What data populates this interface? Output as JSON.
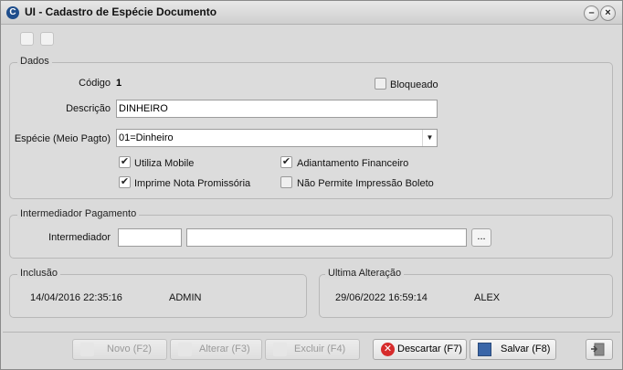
{
  "window": {
    "title": "UI - Cadastro de Espécie Documento",
    "min_symbol": "–",
    "close_symbol": "×",
    "app_icon_letter": "C"
  },
  "dados": {
    "group_label": "Dados",
    "codigo_label": "Código",
    "codigo_value": "1",
    "bloqueado_label": "Bloqueado",
    "bloqueado_checked": false,
    "descricao_label": "Descrição",
    "descricao_value": "DINHEIRO",
    "especie_label": "Espécie (Meio Pagto)",
    "especie_value": "01=Dinheiro",
    "checkboxes": [
      {
        "label": "Utiliza Mobile",
        "checked": true
      },
      {
        "label": "Adiantamento Financeiro",
        "checked": true
      },
      {
        "label": "Imprime Nota Promissória",
        "checked": true
      },
      {
        "label": "Não Permite Impressão Boleto",
        "checked": false
      }
    ]
  },
  "intermediador": {
    "group_label": "Intermediador Pagamento",
    "field_label": "Intermediador",
    "code_value": "",
    "name_value": "",
    "lookup_button": "..."
  },
  "inclusao": {
    "group_label": "Inclusão",
    "datetime": "14/04/2016 22:35:16",
    "user": "ADMIN"
  },
  "ultima_alteracao": {
    "group_label": "Ultima Alteração",
    "datetime": "29/06/2022 16:59:14",
    "user": "ALEX"
  },
  "toolbar": {
    "novo": {
      "label": "Novo (F2)",
      "enabled": false
    },
    "alterar": {
      "label": "Alterar (F3)",
      "enabled": false
    },
    "excluir": {
      "label": "Excluir (F4)",
      "enabled": false
    },
    "descartar": {
      "label": "Descartar (F7)",
      "enabled": true
    },
    "salvar": {
      "label": "Salvar (F8)",
      "enabled": true
    }
  },
  "colors": {
    "window_bg": "#dadada",
    "titlebar": "#d8d8d8",
    "discard_red": "#d62b2b",
    "save_blue": "#3a66a8",
    "disabled_text": "#9a9a9a"
  }
}
